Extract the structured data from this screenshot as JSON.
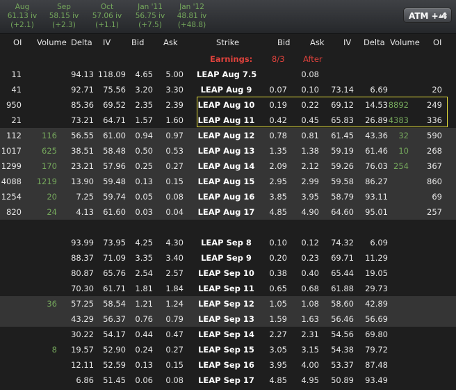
{
  "expirations": [
    {
      "name": "Aug",
      "iv": "61.13 iv",
      "change": "(+2.1)"
    },
    {
      "name": "Sep",
      "iv": "58.15 iv",
      "change": "(+2.3)"
    },
    {
      "name": "Oct",
      "iv": "57.06 iv",
      "change": "(+1.1)"
    },
    {
      "name": "Jan '11",
      "iv": "56.75 iv",
      "change": "(+7.5)"
    },
    {
      "name": "Jan '12",
      "iv": "48.81 iv",
      "change": "(+48.8)"
    }
  ],
  "atm_button": {
    "label": "ATM + 4",
    "caret": "▲▼"
  },
  "columns": [
    "OI",
    "Volume",
    "Delta",
    "IV",
    "Bid",
    "Ask",
    "Strike",
    "Bid",
    "Ask",
    "IV",
    "Delta",
    "Volume",
    "OI"
  ],
  "earnings": {
    "label": "Earnings:",
    "date": "8/3",
    "timing": "After"
  },
  "rows": [
    {
      "c_oi": "11",
      "c_vol": "",
      "c_delta": "94.13",
      "c_iv": "118.09",
      "c_bid": "4.65",
      "c_ask": "5.00",
      "strike": "LEAP Aug 7.5",
      "p_bid": "",
      "p_ask": "0.08",
      "p_iv": "",
      "p_delta": "",
      "p_vol": "",
      "p_oi": ""
    },
    {
      "c_oi": "41",
      "c_vol": "",
      "c_delta": "92.71",
      "c_iv": "75.56",
      "c_bid": "3.20",
      "c_ask": "3.30",
      "strike": "LEAP Aug 9",
      "p_bid": "0.07",
      "p_ask": "0.10",
      "p_iv": "73.14",
      "p_delta": "6.69",
      "p_vol": "",
      "p_oi": "20"
    },
    {
      "c_oi": "950",
      "c_vol": "",
      "c_delta": "85.36",
      "c_iv": "69.52",
      "c_bid": "2.35",
      "c_ask": "2.39",
      "strike": "LEAP Aug 10",
      "p_bid": "0.19",
      "p_ask": "0.22",
      "p_iv": "69.12",
      "p_delta": "14.53",
      "p_vol": "8892",
      "p_oi": "249"
    },
    {
      "c_oi": "21",
      "c_vol": "",
      "c_delta": "73.21",
      "c_iv": "64.71",
      "c_bid": "1.57",
      "c_ask": "1.60",
      "strike": "LEAP Aug 11",
      "p_bid": "0.42",
      "p_ask": "0.45",
      "p_iv": "65.83",
      "p_delta": "26.89",
      "p_vol": "4383",
      "p_oi": "336"
    },
    {
      "c_oi": "112",
      "c_vol": "116",
      "c_delta": "56.55",
      "c_iv": "61.00",
      "c_bid": "0.94",
      "c_ask": "0.97",
      "strike": "LEAP Aug 12",
      "p_bid": "0.78",
      "p_ask": "0.81",
      "p_iv": "61.45",
      "p_delta": "43.36",
      "p_vol": "32",
      "p_oi": "590"
    },
    {
      "c_oi": "1017",
      "c_vol": "625",
      "c_delta": "38.51",
      "c_iv": "58.48",
      "c_bid": "0.50",
      "c_ask": "0.53",
      "strike": "LEAP Aug 13",
      "p_bid": "1.35",
      "p_ask": "1.38",
      "p_iv": "59.19",
      "p_delta": "61.46",
      "p_vol": "10",
      "p_oi": "268"
    },
    {
      "c_oi": "1299",
      "c_vol": "170",
      "c_delta": "23.21",
      "c_iv": "57.96",
      "c_bid": "0.25",
      "c_ask": "0.27",
      "strike": "LEAP Aug 14",
      "p_bid": "2.09",
      "p_ask": "2.12",
      "p_iv": "59.26",
      "p_delta": "76.03",
      "p_vol": "254",
      "p_oi": "367"
    },
    {
      "c_oi": "4088",
      "c_vol": "1219",
      "c_delta": "13.90",
      "c_iv": "59.48",
      "c_bid": "0.13",
      "c_ask": "0.15",
      "strike": "LEAP Aug 15",
      "p_bid": "2.95",
      "p_ask": "2.99",
      "p_iv": "59.58",
      "p_delta": "86.27",
      "p_vol": "",
      "p_oi": "860"
    },
    {
      "c_oi": "1254",
      "c_vol": "20",
      "c_delta": "7.25",
      "c_iv": "59.74",
      "c_bid": "0.05",
      "c_ask": "0.08",
      "strike": "LEAP Aug 16",
      "p_bid": "3.85",
      "p_ask": "3.95",
      "p_iv": "58.79",
      "p_delta": "93.11",
      "p_vol": "",
      "p_oi": "69"
    },
    {
      "c_oi": "820",
      "c_vol": "24",
      "c_delta": "4.13",
      "c_iv": "61.60",
      "c_bid": "0.03",
      "c_ask": "0.04",
      "strike": "LEAP Aug 17",
      "p_bid": "4.85",
      "p_ask": "4.90",
      "p_iv": "64.60",
      "p_delta": "95.01",
      "p_vol": "",
      "p_oi": "257"
    },
    {
      "c_oi": "",
      "c_vol": "",
      "c_delta": "",
      "c_iv": "",
      "c_bid": "",
      "c_ask": "",
      "strike": "",
      "p_bid": "",
      "p_ask": "",
      "p_iv": "",
      "p_delta": "",
      "p_vol": "",
      "p_oi": ""
    },
    {
      "c_oi": "",
      "c_vol": "",
      "c_delta": "93.99",
      "c_iv": "73.95",
      "c_bid": "4.25",
      "c_ask": "4.30",
      "strike": "LEAP Sep 8",
      "p_bid": "0.10",
      "p_ask": "0.12",
      "p_iv": "74.32",
      "p_delta": "6.09",
      "p_vol": "",
      "p_oi": ""
    },
    {
      "c_oi": "",
      "c_vol": "",
      "c_delta": "88.37",
      "c_iv": "71.09",
      "c_bid": "3.35",
      "c_ask": "3.40",
      "strike": "LEAP Sep 9",
      "p_bid": "0.20",
      "p_ask": "0.23",
      "p_iv": "69.71",
      "p_delta": "11.29",
      "p_vol": "",
      "p_oi": ""
    },
    {
      "c_oi": "",
      "c_vol": "",
      "c_delta": "80.87",
      "c_iv": "65.76",
      "c_bid": "2.54",
      "c_ask": "2.57",
      "strike": "LEAP Sep 10",
      "p_bid": "0.38",
      "p_ask": "0.40",
      "p_iv": "65.44",
      "p_delta": "19.05",
      "p_vol": "",
      "p_oi": ""
    },
    {
      "c_oi": "",
      "c_vol": "",
      "c_delta": "70.30",
      "c_iv": "61.71",
      "c_bid": "1.81",
      "c_ask": "1.84",
      "strike": "LEAP Sep 11",
      "p_bid": "0.65",
      "p_ask": "0.68",
      "p_iv": "61.88",
      "p_delta": "29.73",
      "p_vol": "",
      "p_oi": ""
    },
    {
      "c_oi": "",
      "c_vol": "36",
      "c_delta": "57.25",
      "c_iv": "58.54",
      "c_bid": "1.21",
      "c_ask": "1.24",
      "strike": "LEAP Sep 12",
      "p_bid": "1.05",
      "p_ask": "1.08",
      "p_iv": "58.60",
      "p_delta": "42.89",
      "p_vol": "",
      "p_oi": ""
    },
    {
      "c_oi": "",
      "c_vol": "",
      "c_delta": "43.29",
      "c_iv": "56.37",
      "c_bid": "0.76",
      "c_ask": "0.79",
      "strike": "LEAP Sep 13",
      "p_bid": "1.59",
      "p_ask": "1.63",
      "p_iv": "56.46",
      "p_delta": "56.69",
      "p_vol": "",
      "p_oi": ""
    },
    {
      "c_oi": "",
      "c_vol": "",
      "c_delta": "30.22",
      "c_iv": "54.17",
      "c_bid": "0.44",
      "c_ask": "0.47",
      "strike": "LEAP Sep 14",
      "p_bid": "2.27",
      "p_ask": "2.31",
      "p_iv": "54.56",
      "p_delta": "69.80",
      "p_vol": "",
      "p_oi": ""
    },
    {
      "c_oi": "",
      "c_vol": "8",
      "c_delta": "19.57",
      "c_iv": "52.90",
      "c_bid": "0.24",
      "c_ask": "0.27",
      "strike": "LEAP Sep 15",
      "p_bid": "3.05",
      "p_ask": "3.15",
      "p_iv": "54.38",
      "p_delta": "79.72",
      "p_vol": "",
      "p_oi": ""
    },
    {
      "c_oi": "",
      "c_vol": "",
      "c_delta": "12.11",
      "c_iv": "52.59",
      "c_bid": "0.13",
      "c_ask": "0.15",
      "strike": "LEAP Sep 16",
      "p_bid": "3.95",
      "p_ask": "4.00",
      "p_iv": "53.37",
      "p_delta": "87.48",
      "p_vol": "",
      "p_oi": ""
    },
    {
      "c_oi": "",
      "c_vol": "",
      "c_delta": "6.86",
      "c_iv": "51.45",
      "c_bid": "0.06",
      "c_ask": "0.08",
      "strike": "LEAP Sep 17",
      "p_bid": "4.85",
      "p_ask": "4.95",
      "p_iv": "50.89",
      "p_delta": "93.49",
      "p_vol": "",
      "p_oi": ""
    }
  ]
}
